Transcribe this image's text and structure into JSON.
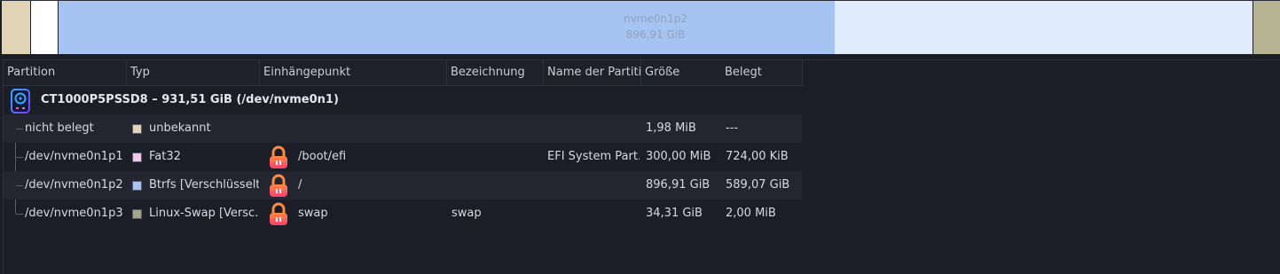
{
  "partition_bar": {
    "main_label": "nvme0n1p2",
    "main_size": "896,91 GiB",
    "colors": {
      "unallocated": "#e0d4b5",
      "fat32": "#ffffff",
      "btrfs_used": "#a6c4f1",
      "btrfs_free": "#e0ebfc",
      "swap": "#b7b494"
    },
    "btrfs_used_fraction": 0.65
  },
  "table": {
    "headers": [
      "Partition",
      "Typ",
      "Einhängepunkt",
      "Bezeichnung",
      "Name der Partition",
      "Größe",
      "Belegt"
    ],
    "disk": {
      "label": "CT1000P5PSSD8 – 931,51 GiB (/dev/nvme0n1)",
      "icon": "drive-icon"
    },
    "rows": [
      {
        "partition": "nicht belegt",
        "type": "unbekannt",
        "type_color": "#e0d4b5",
        "mount": "",
        "label": "",
        "name": "",
        "size": "1,98 MiB",
        "used": "---",
        "locked": false
      },
      {
        "partition": "/dev/nvme0n1p1",
        "type": "Fat32",
        "type_color": "#f1c7f0",
        "mount": "/boot/efi",
        "label": "",
        "name": "EFI System Part…",
        "size": "300,00 MiB",
        "used": "724,00 KiB",
        "locked": true
      },
      {
        "partition": "/dev/nvme0n1p2",
        "type": "Btrfs [Verschlüsselt]",
        "type_color": "#a6c4f1",
        "mount": "/",
        "label": "",
        "name": "",
        "size": "896,91 GiB",
        "used": "589,07 GiB",
        "locked": true
      },
      {
        "partition": "/dev/nvme0n1p3",
        "type": "Linux-Swap [Versc…",
        "type_color": "#a5a58a",
        "mount": "swap",
        "label": "swap",
        "name": "",
        "size": "34,31 GiB",
        "used": "2,00 MiB",
        "locked": true
      }
    ]
  }
}
